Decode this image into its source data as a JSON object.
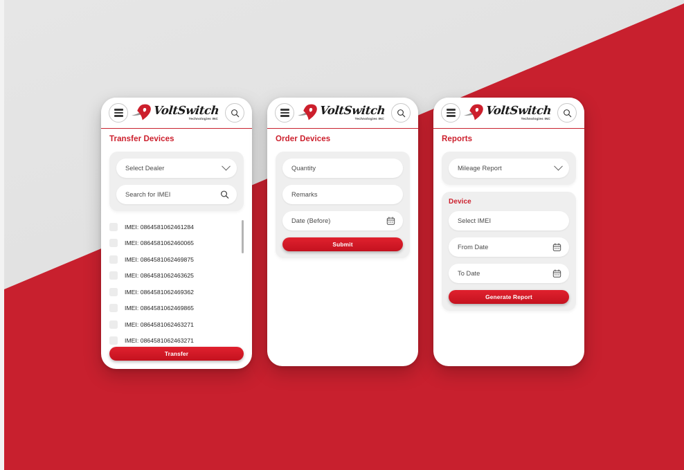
{
  "background": {
    "grey": "#e3e3e3",
    "red": "#c8202e",
    "left_strip": "#f3f3f3"
  },
  "brand": {
    "name": "VoltSwitch",
    "tagline": "Technologies INC",
    "accent": "#cc1f2c",
    "logo_icon": "voltswitch-logo-mark"
  },
  "header": {
    "menu_icon": "hamburger-menu-icon",
    "search_icon": "search-icon"
  },
  "screens": [
    {
      "id": "transfer-devices",
      "title": "Transfer Devices",
      "dealer_select": {
        "placeholder": "Select Dealer",
        "icon": "chevron-down-icon"
      },
      "imei_search": {
        "placeholder": "Search for IMEI",
        "icon": "search-icon"
      },
      "imei_items": [
        "IMEI: 0864581062461284",
        "IMEI: 0864581062460065",
        "IMEI: 0864581062469875",
        "IMEI: 0864581062463625",
        "IMEI: 0864581062469362",
        "IMEI: 0864581062469865",
        "IMEI: 0864581062463271",
        "IMEI: 0864581062463271"
      ],
      "submit_label": "Transfer"
    },
    {
      "id": "order-devices",
      "title": "Order Devices",
      "fields": [
        {
          "placeholder": "Quantity",
          "icon": null
        },
        {
          "placeholder": "Remarks",
          "icon": null
        },
        {
          "placeholder": "Date (Before)",
          "icon": "calendar-icon"
        }
      ],
      "submit_label": "Submit"
    },
    {
      "id": "reports",
      "title": "Reports",
      "report_type": {
        "value": "Mileage Report",
        "icon": "chevron-down-icon"
      },
      "device_section": {
        "title": "Device",
        "fields": [
          {
            "placeholder": "Select IMEI",
            "icon": null
          },
          {
            "placeholder": "From Date",
            "icon": "calendar-icon"
          },
          {
            "placeholder": "To Date",
            "icon": "calendar-icon"
          }
        ]
      },
      "submit_label": "Generate Report"
    }
  ]
}
